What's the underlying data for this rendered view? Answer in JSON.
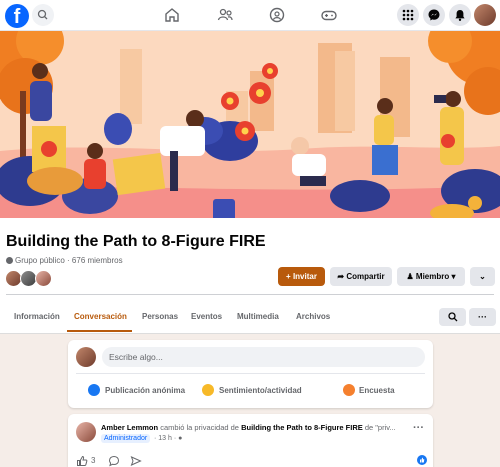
{
  "topbar": {
    "logo_glyph": "f",
    "icons": [
      "facebook-logo",
      "search-icon",
      "home-icon",
      "friends-icon",
      "groups-icon",
      "gaming-icon",
      "menu-grid-icon",
      "messenger-icon",
      "bell-icon",
      "account-avatar"
    ]
  },
  "group": {
    "title": "Building the Path to 8-Figure FIRE",
    "meta": "Grupo público · 676 miembros"
  },
  "actions": {
    "invite": "+ Invitar",
    "share": "Compartir",
    "member": "Miembro",
    "more_glyph": "⌄"
  },
  "tabs": [
    {
      "label": "Información"
    },
    {
      "label": "Conversación",
      "active": true
    },
    {
      "label": "Personas"
    },
    {
      "label": "Eventos"
    },
    {
      "label": "Multimedia"
    },
    {
      "label": "Archivos"
    }
  ],
  "tab_tools": {
    "search_glyph": "⌕",
    "more_glyph": "···"
  },
  "composer": {
    "placeholder": "Escribe algo...",
    "actions": [
      {
        "label": "Publicación anónima",
        "color": "#1877f2"
      },
      {
        "label": "Sentimiento/actividad",
        "color": "#f7b928"
      },
      {
        "label": "Encuesta",
        "color": "#f5802e"
      }
    ]
  },
  "post": {
    "author": "Amber Lemmon",
    "text_mid": "cambió la privacidad de",
    "group": "Building the Path to 8-Figure FIRE",
    "text_end": "de \"priv...",
    "role": "Administrador",
    "time": "· 13 h ·",
    "like_count": "3",
    "more_glyph": "···"
  },
  "colors": {
    "accent": "#b85a0c",
    "facebook_blue": "#0866ff"
  }
}
